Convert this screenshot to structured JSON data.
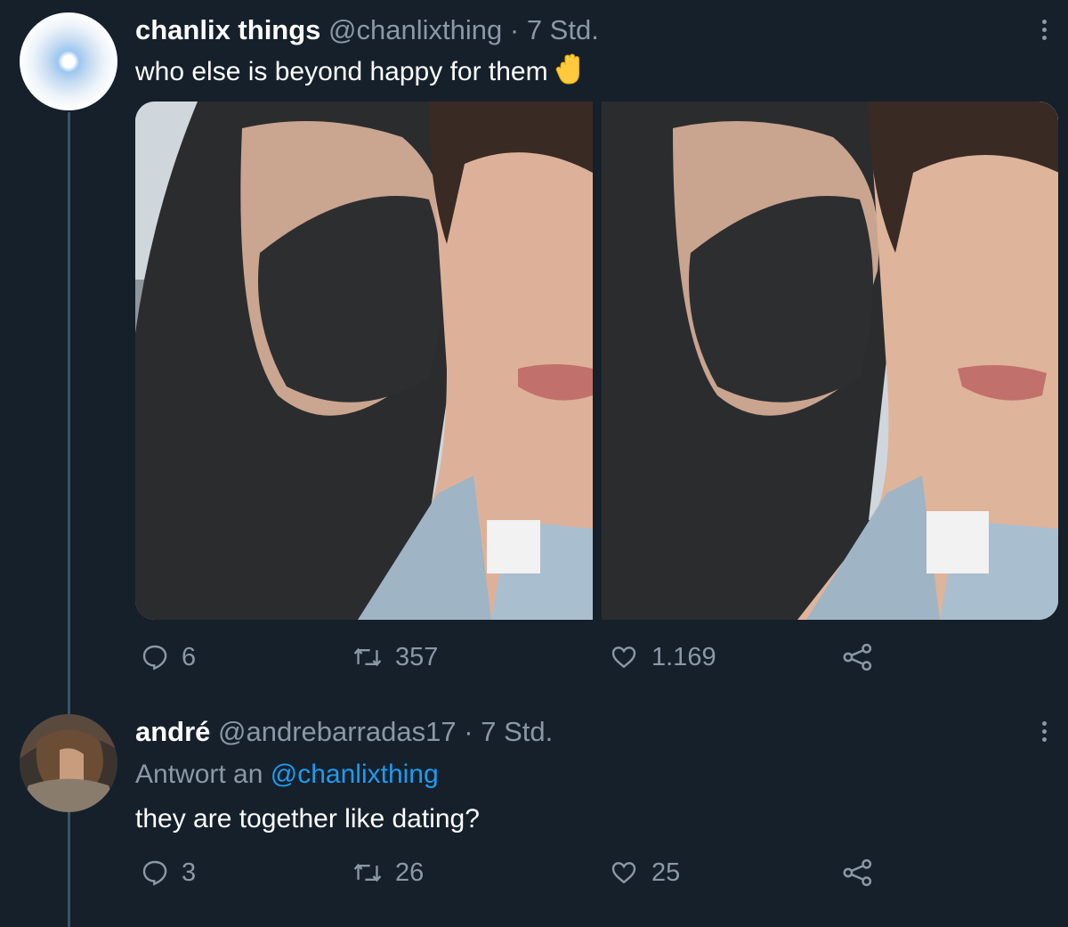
{
  "tweets": [
    {
      "name": "chanlix things",
      "handle": "@chanlixthing",
      "separator": "·",
      "time": "7 Std.",
      "text": "who else is beyond happy for them",
      "emoji": "raised-hand",
      "stats": {
        "replies": "6",
        "retweets": "357",
        "likes": "1.169"
      }
    },
    {
      "name": "andré",
      "handle": "@andrebarradas17",
      "separator": "·",
      "time": "7 Std.",
      "reply_prefix": "Antwort an",
      "reply_mention": "@chanlixthing",
      "text": "they are together like dating?",
      "stats": {
        "replies": "3",
        "retweets": "26",
        "likes": "25"
      }
    }
  ],
  "colors": {
    "background": "#15202b",
    "secondary_text": "#8b98a5",
    "link": "#1d9bf0",
    "thread_line": "#3d5466"
  },
  "icons": [
    "more-icon",
    "reply-icon",
    "retweet-icon",
    "like-icon",
    "share-icon",
    "raised-hand-emoji"
  ]
}
